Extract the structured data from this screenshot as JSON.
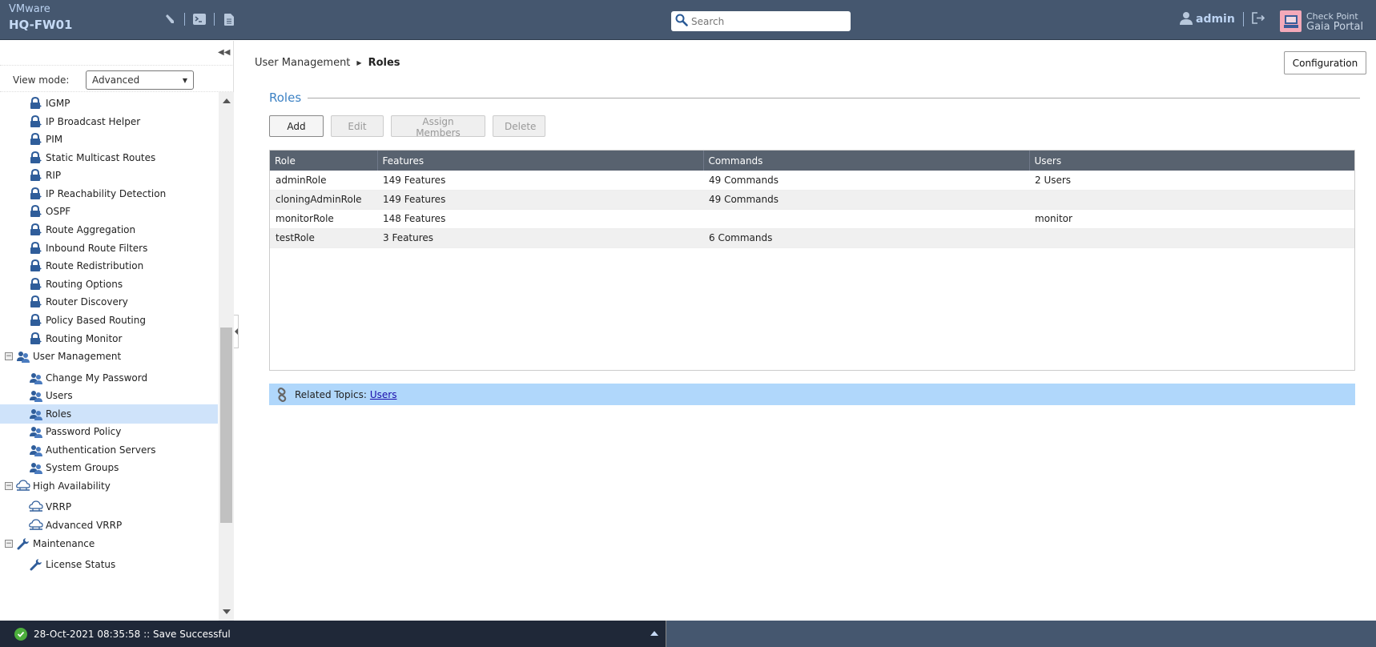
{
  "header": {
    "vendor": "VMware",
    "hostname": "HQ-FW01",
    "tools": [
      {
        "icon": "pencil-icon"
      },
      {
        "icon": "terminal-icon"
      },
      {
        "icon": "document-icon"
      }
    ],
    "search": {
      "placeholder": "Search",
      "value": ""
    },
    "user": "admin",
    "logout_icon": "logout-icon",
    "logo": {
      "line1": "Check Point",
      "line2": "Gaia Portal"
    }
  },
  "sidebar": {
    "view_mode_label": "View mode:",
    "view_mode_value": "Advanced",
    "tree": [
      {
        "label": "IGMP",
        "level": "child",
        "icon": "lock-icon"
      },
      {
        "label": "IP Broadcast Helper",
        "level": "child",
        "icon": "lock-icon"
      },
      {
        "label": "PIM",
        "level": "child",
        "icon": "lock-icon"
      },
      {
        "label": "Static Multicast Routes",
        "level": "child",
        "icon": "lock-icon"
      },
      {
        "label": "RIP",
        "level": "child",
        "icon": "lock-icon"
      },
      {
        "label": "IP Reachability Detection",
        "level": "child",
        "icon": "lock-icon"
      },
      {
        "label": "OSPF",
        "level": "child",
        "icon": "lock-icon"
      },
      {
        "label": "Route Aggregation",
        "level": "child",
        "icon": "lock-icon"
      },
      {
        "label": "Inbound Route Filters",
        "level": "child",
        "icon": "lock-icon"
      },
      {
        "label": "Route Redistribution",
        "level": "child",
        "icon": "lock-icon"
      },
      {
        "label": "Routing Options",
        "level": "child",
        "icon": "lock-icon"
      },
      {
        "label": "Router Discovery",
        "level": "child",
        "icon": "lock-icon"
      },
      {
        "label": "Policy Based Routing",
        "level": "child",
        "icon": "lock-icon"
      },
      {
        "label": "Routing Monitor",
        "level": "child",
        "icon": "lock-icon"
      },
      {
        "label": "User Management",
        "level": "parent",
        "icon": "users-icon",
        "expanded": true
      },
      {
        "label": "Change My Password",
        "level": "child",
        "icon": "users-icon"
      },
      {
        "label": "Users",
        "level": "child",
        "icon": "users-icon"
      },
      {
        "label": "Roles",
        "level": "child",
        "icon": "users-icon",
        "selected": true
      },
      {
        "label": "Password Policy",
        "level": "child",
        "icon": "users-icon"
      },
      {
        "label": "Authentication Servers",
        "level": "child",
        "icon": "users-icon"
      },
      {
        "label": "System Groups",
        "level": "child",
        "icon": "users-icon"
      },
      {
        "label": "High Availability",
        "level": "parent",
        "icon": "cloud-icon",
        "expanded": true
      },
      {
        "label": "VRRP",
        "level": "child",
        "icon": "cloud-icon"
      },
      {
        "label": "Advanced VRRP",
        "level": "child",
        "icon": "cloud-icon"
      },
      {
        "label": "Maintenance",
        "level": "parent",
        "icon": "wrench-icon",
        "expanded": true
      },
      {
        "label": "License Status",
        "level": "child",
        "icon": "wrench-icon"
      }
    ]
  },
  "main": {
    "breadcrumb": {
      "parent": "User Management",
      "current": "Roles"
    },
    "config_button": "Configuration",
    "section_title": "Roles",
    "toolbar": {
      "add": "Add",
      "edit": "Edit",
      "assign": "Assign Members",
      "delete": "Delete"
    },
    "table": {
      "columns": [
        "Role",
        "Features",
        "Commands",
        "Users"
      ],
      "rows": [
        [
          "adminRole",
          "149 Features",
          "49 Commands",
          "2 Users"
        ],
        [
          "cloningAdminRole",
          "149 Features",
          "49 Commands",
          ""
        ],
        [
          "monitorRole",
          "148 Features",
          "",
          "monitor"
        ],
        [
          "testRole",
          "3 Features",
          "6 Commands",
          ""
        ]
      ]
    },
    "related": {
      "label": "Related Topics:",
      "link": "Users"
    }
  },
  "status": {
    "message": "28-Oct-2021 08:35:58 :: Save Successful"
  }
}
